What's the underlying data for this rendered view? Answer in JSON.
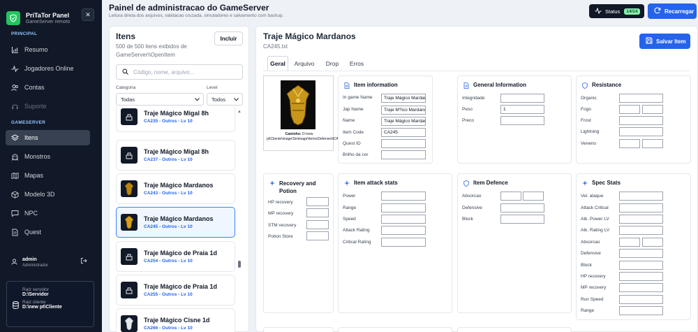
{
  "brand": {
    "title": "PriTaTor Panel",
    "subtitle": "GameServer remoto"
  },
  "sidebar": {
    "principal_label": "PRINCIPAL",
    "gameserver_label": "GAMESERVER",
    "principal": [
      {
        "label": "Resumo"
      },
      {
        "label": "Jogadores Online"
      },
      {
        "label": "Contas"
      },
      {
        "label": "Suporte"
      }
    ],
    "gameserver": [
      {
        "label": "Itens"
      },
      {
        "label": "Monstros"
      },
      {
        "label": "Mapas"
      },
      {
        "label": "Modelo 3D"
      },
      {
        "label": "NPC"
      },
      {
        "label": "Quest"
      }
    ],
    "user": {
      "name": "admin",
      "role": "Administrador"
    },
    "paths": {
      "server_label": "Raiz servidor",
      "server_value": "D:\\Servidor",
      "client_label": "Raiz cliente",
      "client_value": "D:\\new pt\\Cliente"
    }
  },
  "header": {
    "title": "Painel de administracao do GameServer",
    "subtitle": "Leitura direta dos arquivos, validacao cruzada, simuladores e salvamento com backup.",
    "status_label": "Status",
    "status_badge": "14/14",
    "reload_label": "Recarregar"
  },
  "items": {
    "title": "Itens",
    "subtitle": "500 de 500 itens exibidos de GameServer\\\\OpenItem",
    "add_label": "Incluir",
    "search_placeholder": "Código, nome, arquivo...",
    "category_label": "Categoria",
    "category_value": "Todas",
    "level_label": "Level",
    "level_value": "Todos",
    "list": [
      {
        "name": "Traje Mágico Migal 8h",
        "meta": "CA235 - Outros - Lv 10"
      },
      {
        "name": "Traje Mágico Migal 8h",
        "meta": "CA237 - Outros - Lv 10"
      },
      {
        "name": "Traje Mágico Mardanos",
        "meta": "CA243 - Outros - Lv 10"
      },
      {
        "name": "Traje Mágico Mardanos",
        "meta": "CA245 - Outros - Lv 10"
      },
      {
        "name": "Traje Mágico de Praia 1d",
        "meta": "CA254 - Outros - Lv 10"
      },
      {
        "name": "Traje Mágico de Praia 1d",
        "meta": "CA255 - Outros - Lv 10"
      },
      {
        "name": "Traje Mágico Cisne 1d",
        "meta": "CA266 - Outros - Lv 10"
      }
    ]
  },
  "detail": {
    "title": "Traje Mágico Mardanos",
    "file": "CA245.txt",
    "save_label": "Salvar Item",
    "tabs": [
      "Geral",
      "Arquivo",
      "Drop",
      "Erros"
    ],
    "image_caption": "Caminho: D:\\new pt\\Cliente\\image\\Sinimage\\Items\\Defense\\itCA245.BMP",
    "caption_prefix": "Caminho:",
    "caption_path": "D:\\new pt\\Cliente\\image\\Sinimage\\Items\\Defense\\itCA245.BMP",
    "item_info": {
      "title": "Item information",
      "fields": [
        {
          "label": "In game Name",
          "value": "Traje Mágico Mardanos"
        },
        {
          "label": "Jap Name",
          "value": "Traje M?ico Mardanos"
        },
        {
          "label": "Name",
          "value": "Traje Mágico Mardanos"
        },
        {
          "label": "Item Code",
          "value": "CA245"
        },
        {
          "label": "Quest ID",
          "value": ""
        },
        {
          "label": "Brilho da cor",
          "value": ""
        }
      ]
    },
    "general": {
      "title": "General Information",
      "fields": [
        {
          "label": "Integridade",
          "value": ""
        },
        {
          "label": "Peso",
          "value": "1"
        },
        {
          "label": "Preco",
          "value": ""
        }
      ]
    },
    "resistance": {
      "title": "Resistance",
      "fields": [
        {
          "label": "Organic"
        },
        {
          "label": "Fogo"
        },
        {
          "label": "Frost"
        },
        {
          "label": "Lightning"
        },
        {
          "label": "Veneno"
        }
      ]
    },
    "recovery": {
      "title": "Recovery and Potion",
      "fields": [
        {
          "label": "HP recovery"
        },
        {
          "label": "MP recovery"
        },
        {
          "label": "STM recovery"
        },
        {
          "label": "Potion Store"
        }
      ]
    },
    "attack": {
      "title": "Item attack stats",
      "fields": [
        {
          "label": "Power"
        },
        {
          "label": "Range"
        },
        {
          "label": "Speed"
        },
        {
          "label": "Attack Rating"
        },
        {
          "label": "Critical Rating"
        }
      ]
    },
    "defence": {
      "title": "Item Defence",
      "fields": [
        {
          "label": "Absorcao"
        },
        {
          "label": "Defensive"
        },
        {
          "label": "Block"
        }
      ]
    },
    "spec": {
      "title": "Spec Stats",
      "fields": [
        {
          "label": "Vel. ataque"
        },
        {
          "label": "Attack Critical"
        },
        {
          "label": "Atk. Power LV"
        },
        {
          "label": "Atk. Rating LV"
        },
        {
          "label": "Absorcao"
        },
        {
          "label": "Defensive"
        },
        {
          "label": "Block"
        },
        {
          "label": "HP recovery"
        },
        {
          "label": "MP recovery"
        },
        {
          "label": "Run Speed"
        },
        {
          "label": "Range"
        }
      ]
    }
  },
  "colors": {
    "accent": "#2563eb",
    "sidebar": "#111827",
    "brand": "#22c55e",
    "status_badge": "#86efac"
  }
}
